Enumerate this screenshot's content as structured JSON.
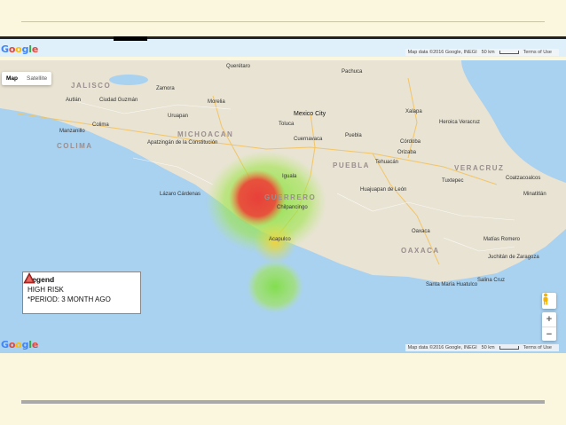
{
  "top_strip": {
    "attribution": {
      "map_data": "Map data ©2016 Google, INEGI",
      "scale": "50 km",
      "terms": "Terms of Use"
    }
  },
  "map": {
    "type_buttons": [
      "Map",
      "Satellite"
    ],
    "active_type": "Map",
    "attribution": {
      "map_data": "Map data ©2016 Google, INEGI",
      "scale": "50 km",
      "terms": "Terms of Use"
    },
    "regions": [
      "JALISCO",
      "COLIMA",
      "MICHOACAN",
      "GUERRERO",
      "PUEBLA",
      "VERACRUZ",
      "OAXACA"
    ],
    "cities": {
      "mexico_city": "Mexico City",
      "morelia": "Morelia",
      "toluca": "Toluca",
      "cuernavaca": "Cuernavaca",
      "puebla": "Puebla",
      "xalapa": "Xalapa",
      "heroica_veracruz": "Heroica Veracruz",
      "cordoba": "Córdoba",
      "orizaba": "Orizaba",
      "tehuacan": "Tehuacán",
      "chilpancingo": "Chilpancingo",
      "acapulco": "Acapulco",
      "oaxaca": "Oaxaca",
      "colima": "Colima",
      "manzanillo": "Manzanillo",
      "uruapan": "Uruapan",
      "zamora": "Zamora",
      "ciudad_guzman": "Ciudad Guzmán",
      "lazaro_cardenas": "Lázaro Cárdenas",
      "coatzacoalcos": "Coatzacoalcos",
      "minatitlan": "Minatitlán",
      "tuxtepec": "Tuxtepec",
      "matias_romero": "Matías Romero",
      "juchitan": "Juchitán de Zaragoza",
      "salina_cruz": "Salina Cruz",
      "santa_maria_huatulco": "Santa María Huatulco",
      "autlan": "Autlán",
      "apatzingan": "Apatzingán de la Constitución",
      "huajuapan": "Huajuapan de León",
      "iguala": "Iguala",
      "queretaro": "Querétaro",
      "pachuca": "Pachuca"
    },
    "legend": {
      "title": "Legend",
      "item": "HIGH RISK",
      "period": "*PERIOD: 3 MONTH AGO"
    },
    "heat_colors": {
      "high": "#e8403a",
      "medium": "#f2d23c",
      "low": "#7ee03c"
    }
  },
  "logo": "Google"
}
